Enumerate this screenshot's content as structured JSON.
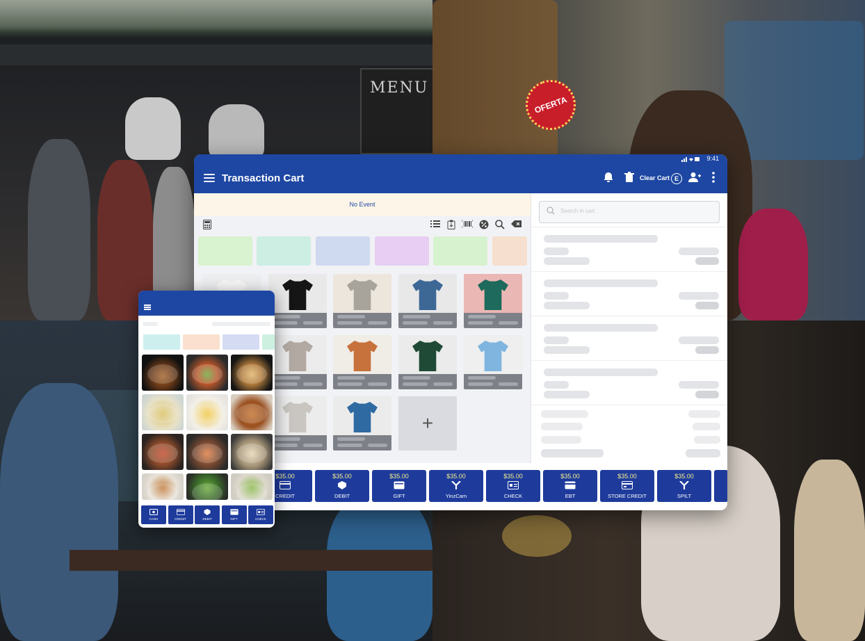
{
  "background": {
    "menu_board_text": "MENU",
    "offer_sign_text": "OFERTA"
  },
  "tablet": {
    "status_time": "9:41",
    "title": "Transaction Cart",
    "clear_cart_label": "Clear Cart",
    "employee_badge": "E",
    "event_label": "No Event",
    "search_placeholder": "Search in cart",
    "payment_buttons": [
      {
        "amount": "$35.00",
        "label": "CREDIT",
        "icon": "credit-icon"
      },
      {
        "amount": "$35.00",
        "label": "DEBIT",
        "icon": "debit-icon"
      },
      {
        "amount": "$35.00",
        "label": "GIFT",
        "icon": "gift-card-icon"
      },
      {
        "amount": "$35.00",
        "label": "YinzCam",
        "icon": "yinzcam-icon"
      },
      {
        "amount": "$35.00",
        "label": "CHECK",
        "icon": "check-icon"
      },
      {
        "amount": "$35.00",
        "label": "EBT",
        "icon": "ebt-icon"
      },
      {
        "amount": "$35.00",
        "label": "STORE CREDIT",
        "icon": "store-credit-icon"
      },
      {
        "amount": "$35.00",
        "label": "SPILT",
        "icon": "split-icon"
      }
    ],
    "add_product_glyph": "+",
    "colors": {
      "primary": "#1e47a3",
      "pay_button": "#1e3b9c",
      "amount_text": "#f4ee8a",
      "event_bar": "#fdf6e8"
    }
  },
  "phone": {
    "payment_buttons": [
      {
        "label": "CASH",
        "icon": "cash-icon"
      },
      {
        "label": "CREDIT",
        "icon": "credit-icon"
      },
      {
        "label": "DEBIT",
        "icon": "debit-icon"
      },
      {
        "label": "GIFT",
        "icon": "gift-card-icon"
      },
      {
        "label": "CHECK",
        "icon": "check-icon"
      }
    ]
  }
}
